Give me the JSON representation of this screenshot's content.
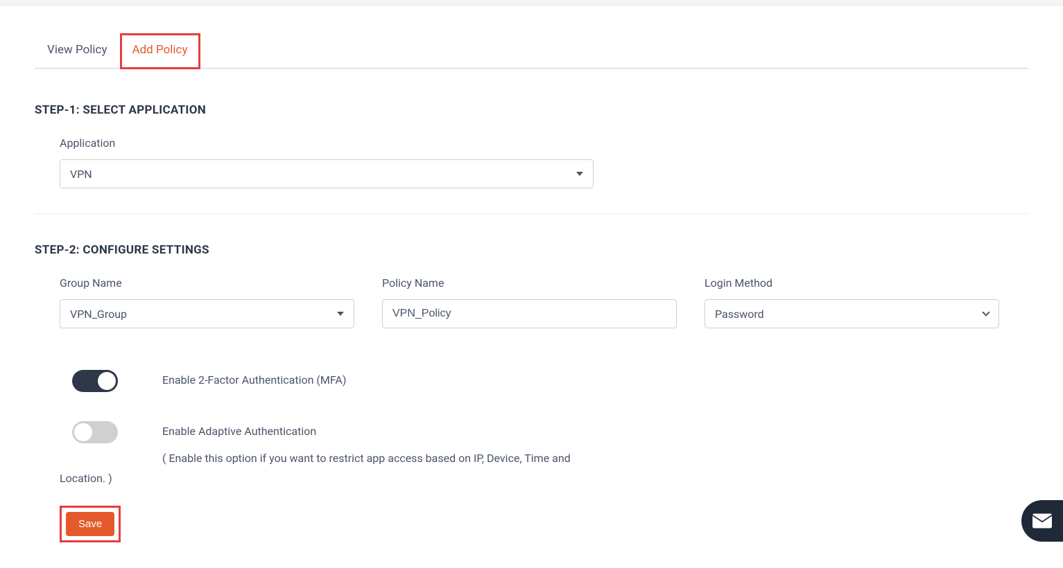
{
  "tabs": {
    "view": "View Policy",
    "add": "Add Policy"
  },
  "step1": {
    "header": "STEP-1: SELECT APPLICATION",
    "applicationLabel": "Application",
    "applicationValue": "VPN"
  },
  "step2": {
    "header": "STEP-2: CONFIGURE SETTINGS",
    "groupNameLabel": "Group Name",
    "groupNameValue": "VPN_Group",
    "policyNameLabel": "Policy Name",
    "policyNameValue": "VPN_Policy",
    "loginMethodLabel": "Login Method",
    "loginMethodValue": "Password",
    "mfaLabel": "Enable 2-Factor Authentication (MFA)",
    "adaptiveLabel": "Enable Adaptive Authentication",
    "adaptiveDescLine1": "( Enable this option if you want to restrict app access based on IP, Device, Time and",
    "adaptiveDescLine2": "Location. )",
    "saveLabel": "Save"
  }
}
